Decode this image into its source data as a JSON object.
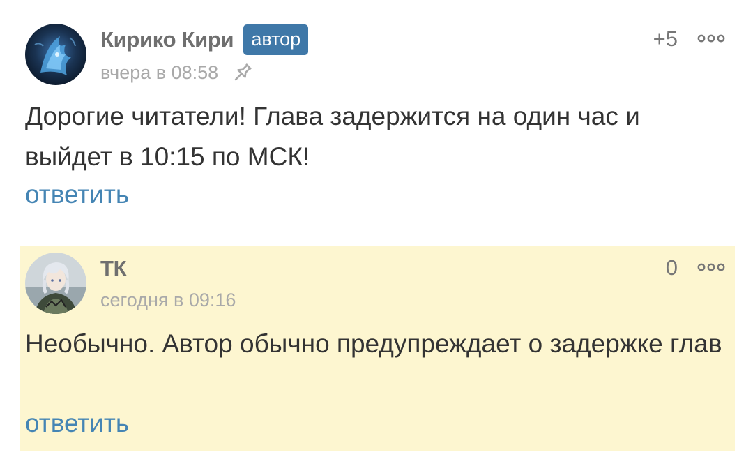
{
  "comments": [
    {
      "author": "Кирико Кири",
      "badge": "автор",
      "timestamp": "вчера в 08:58",
      "pinned": true,
      "rating": "+5",
      "text": "Дорогие читатели! Глава задержится на один час и выйдет в 10:15 по МСК!",
      "reply_label": "ответить",
      "highlighted": false,
      "avatar_icon": "blue-fox-avatar-icon"
    },
    {
      "author": "ТК",
      "timestamp": "сегодня в 09:16",
      "rating": "0",
      "text": "Необычно. Автор обычно предупреждает о задержке глав",
      "reply_label": "ответить",
      "highlighted": true,
      "avatar_icon": "anime-character-avatar-icon"
    }
  ],
  "colors": {
    "accent": "#4585b4",
    "badge_bg": "#3f78a8",
    "highlight_bg": "#fdf6d0",
    "meta_text": "#a9a9a9",
    "author_text": "#6f6f6f"
  },
  "icons": {
    "pin": "pin-icon",
    "more": "more-options-icon"
  }
}
